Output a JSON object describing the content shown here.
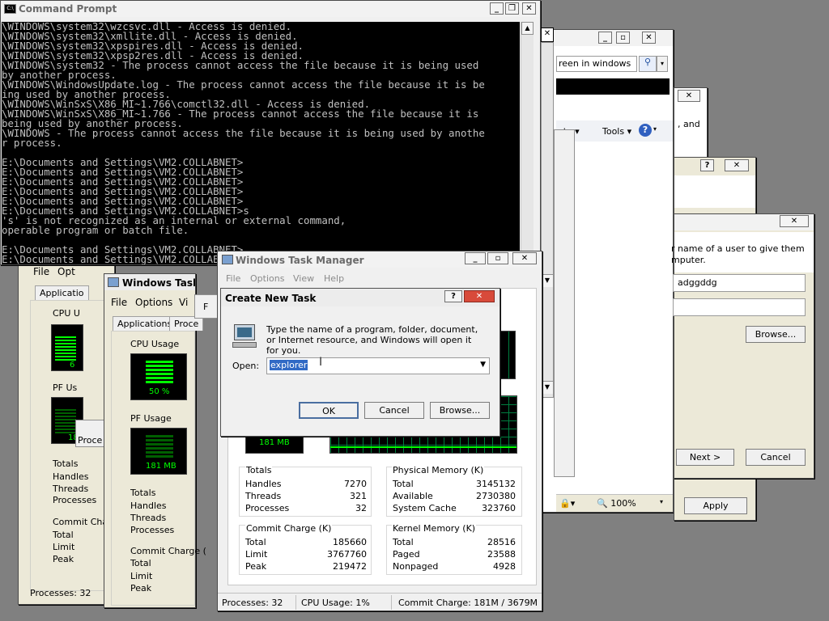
{
  "cmd": {
    "title": "Command Prompt",
    "lines": [
      "\\WINDOWS\\system32\\wzcsvc.dll - Access is denied.",
      "\\WINDOWS\\system32\\xmllite.dll - Access is denied.",
      "\\WINDOWS\\system32\\xpspires.dll - Access is denied.",
      "\\WINDOWS\\system32\\xpsp2res.dll - Access is denied.",
      "\\WINDOWS\\system32 - The process cannot access the file because it is being used",
      "by another process.",
      "\\WINDOWS\\WindowsUpdate.log - The process cannot access the file because it is be",
      "ing used by another process.",
      "\\WINDOWS\\WinSxS\\X86_MI~1.766\\comctl32.dll - Access is denied.",
      "\\WINDOWS\\WinSxS\\X86_MI~1.766 - The process cannot access the file because it is",
      "being used by another process.",
      "\\WINDOWS - The process cannot access the file because it is being used by anothe",
      "r process.",
      "",
      "E:\\Documents and Settings\\VM2.COLLABNET>",
      "E:\\Documents and Settings\\VM2.COLLABNET>",
      "E:\\Documents and Settings\\VM2.COLLABNET>",
      "E:\\Documents and Settings\\VM2.COLLABNET>",
      "E:\\Documents and Settings\\VM2.COLLABNET>",
      "E:\\Documents and Settings\\VM2.COLLABNET>s",
      "'s' is not recognized as an internal or external command,",
      "operable program or batch file.",
      "",
      "E:\\Documents and Settings\\VM2.COLLABNET>",
      "E:\\Documents and Settings\\VM2.COLLABNET>"
    ]
  },
  "browser": {
    "search_text": "reen in windows",
    "toolbar": [
      "ety ▾",
      "Tools ▾"
    ],
    "zoom": "🔍 100%"
  },
  "frag": {
    "and": ", and"
  },
  "user_dialog": {
    "prompt": "r name of a user to give them",
    "prompt2": "mputer.",
    "username": "adggddg",
    "browse": "Browse...",
    "next": "Next >",
    "cancel": "Cancel"
  },
  "props": {
    "apply": "Apply"
  },
  "tm_back": {
    "menu": [
      "File",
      "Opt"
    ],
    "tab": "Applicatio",
    "cpu_label": "CPU U",
    "pf_label": "PF Us",
    "cpu_val": "6",
    "pf_val": "18",
    "totals": [
      "Totals",
      "Handles",
      "Threads",
      "Processes"
    ],
    "commit": [
      "Commit Charge",
      "Total",
      "Limit",
      "Peak"
    ],
    "status": "Processes: 32",
    "proce": "Proce"
  },
  "tm_mid": {
    "title": "Windows Task M",
    "menu": [
      "File",
      "Options",
      "Vi"
    ],
    "tabs": [
      "Applications",
      "Proce"
    ],
    "cpu_usage": "CPU Usage",
    "cpu_val": "50 %",
    "pf_usage": "PF Usage",
    "pf_val": "181 MB",
    "totals": [
      "Totals",
      "Handles",
      "Threads",
      "Processes"
    ],
    "commit": [
      "Commit Charge (",
      "Total",
      "Limit",
      "Peak"
    ],
    "f": "F"
  },
  "tm": {
    "title": "Windows Task Manager",
    "menu": [
      "File",
      "Options",
      "View",
      "Help"
    ],
    "pf_val": "181 MB",
    "totals_title": "Totals",
    "totals": [
      [
        "Handles",
        "7270"
      ],
      [
        "Threads",
        "321"
      ],
      [
        "Processes",
        "32"
      ]
    ],
    "phys_title": "Physical Memory (K)",
    "phys": [
      [
        "Total",
        "3145132"
      ],
      [
        "Available",
        "2730380"
      ],
      [
        "System Cache",
        "323760"
      ]
    ],
    "commit_title": "Commit Charge (K)",
    "commit": [
      [
        "Total",
        "185660"
      ],
      [
        "Limit",
        "3767760"
      ],
      [
        "Peak",
        "219472"
      ]
    ],
    "kernel_title": "Kernel Memory (K)",
    "kernel": [
      [
        "Total",
        "28516"
      ],
      [
        "Paged",
        "23588"
      ],
      [
        "Nonpaged",
        "4928"
      ]
    ],
    "status": [
      "Processes: 32",
      "CPU Usage: 1%",
      "Commit Charge: 181M / 3679M"
    ]
  },
  "run": {
    "title": "Create New Task",
    "desc": "Type the name of a program, folder, document, or Internet resource, and Windows will open it for you.",
    "open_label": "Open:",
    "value": "explorer",
    "ok": "OK",
    "cancel": "Cancel",
    "browse": "Browse..."
  },
  "colors": {
    "monitor_green": "#00ff00",
    "grid": "#008040",
    "selection": "#316ac5"
  }
}
